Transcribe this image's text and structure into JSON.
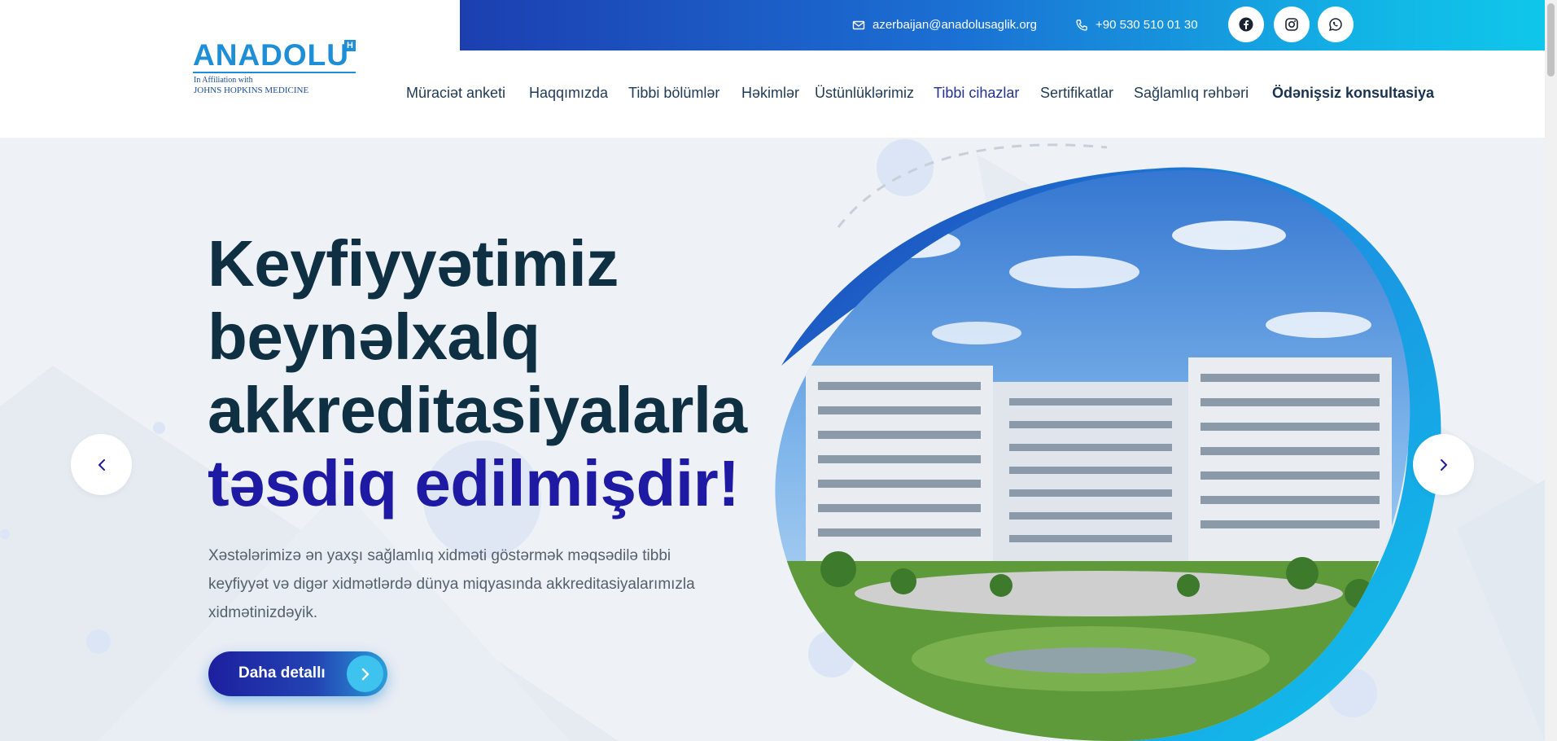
{
  "brand": {
    "name": "ANADOLU",
    "badge": "H",
    "affiliation_line1": "In Affiliation with",
    "affiliation_line2": "JOHNS HOPKINS MEDICINE",
    "color": "#1e8ed6"
  },
  "topbar": {
    "email": "azerbaijan@anadolusaglik.org",
    "phone": "+90 530 510 01 30",
    "social": [
      {
        "icon": "facebook-icon"
      },
      {
        "icon": "instagram-icon"
      },
      {
        "icon": "whatsapp-icon"
      }
    ]
  },
  "nav": {
    "items": [
      {
        "label": "Müraciət anketi"
      },
      {
        "label": "Haqqımızda"
      },
      {
        "label": "Tibbi bölümlər"
      },
      {
        "label": "Həkimlər"
      },
      {
        "label": "Üstünlüklərimiz"
      },
      {
        "label": "Tibbi cihazlar"
      },
      {
        "label": "Sertifikatlar"
      },
      {
        "label": "Sağlamlıq rəhbəri"
      },
      {
        "label": "Ödənişsiz konsultasiya"
      }
    ]
  },
  "hero": {
    "headline_line1": "Keyfiyyətimiz",
    "headline_line2": "beynəlxalq",
    "headline_line3": "akkreditasiyalarla",
    "headline_line4": "təsdiq edilmişdir!",
    "description": "Xəstələrimizə ən yaxşı sağlamlıq xidməti göstərmək məqsədilə tibbi keyfiyyət və digər xidmətlərdə dünya miqyasında akkreditasiyalarımızla xidmətinizdəyik.",
    "cta_label": "Daha detallı",
    "image_subject": "hospital-building-photo"
  },
  "colors": {
    "headline": "#0f3043",
    "accent": "#1f1aa3",
    "topbar_start": "#1c3fb0",
    "topbar_end": "#0fc7ea",
    "hero_bg": "#eef2f7"
  }
}
